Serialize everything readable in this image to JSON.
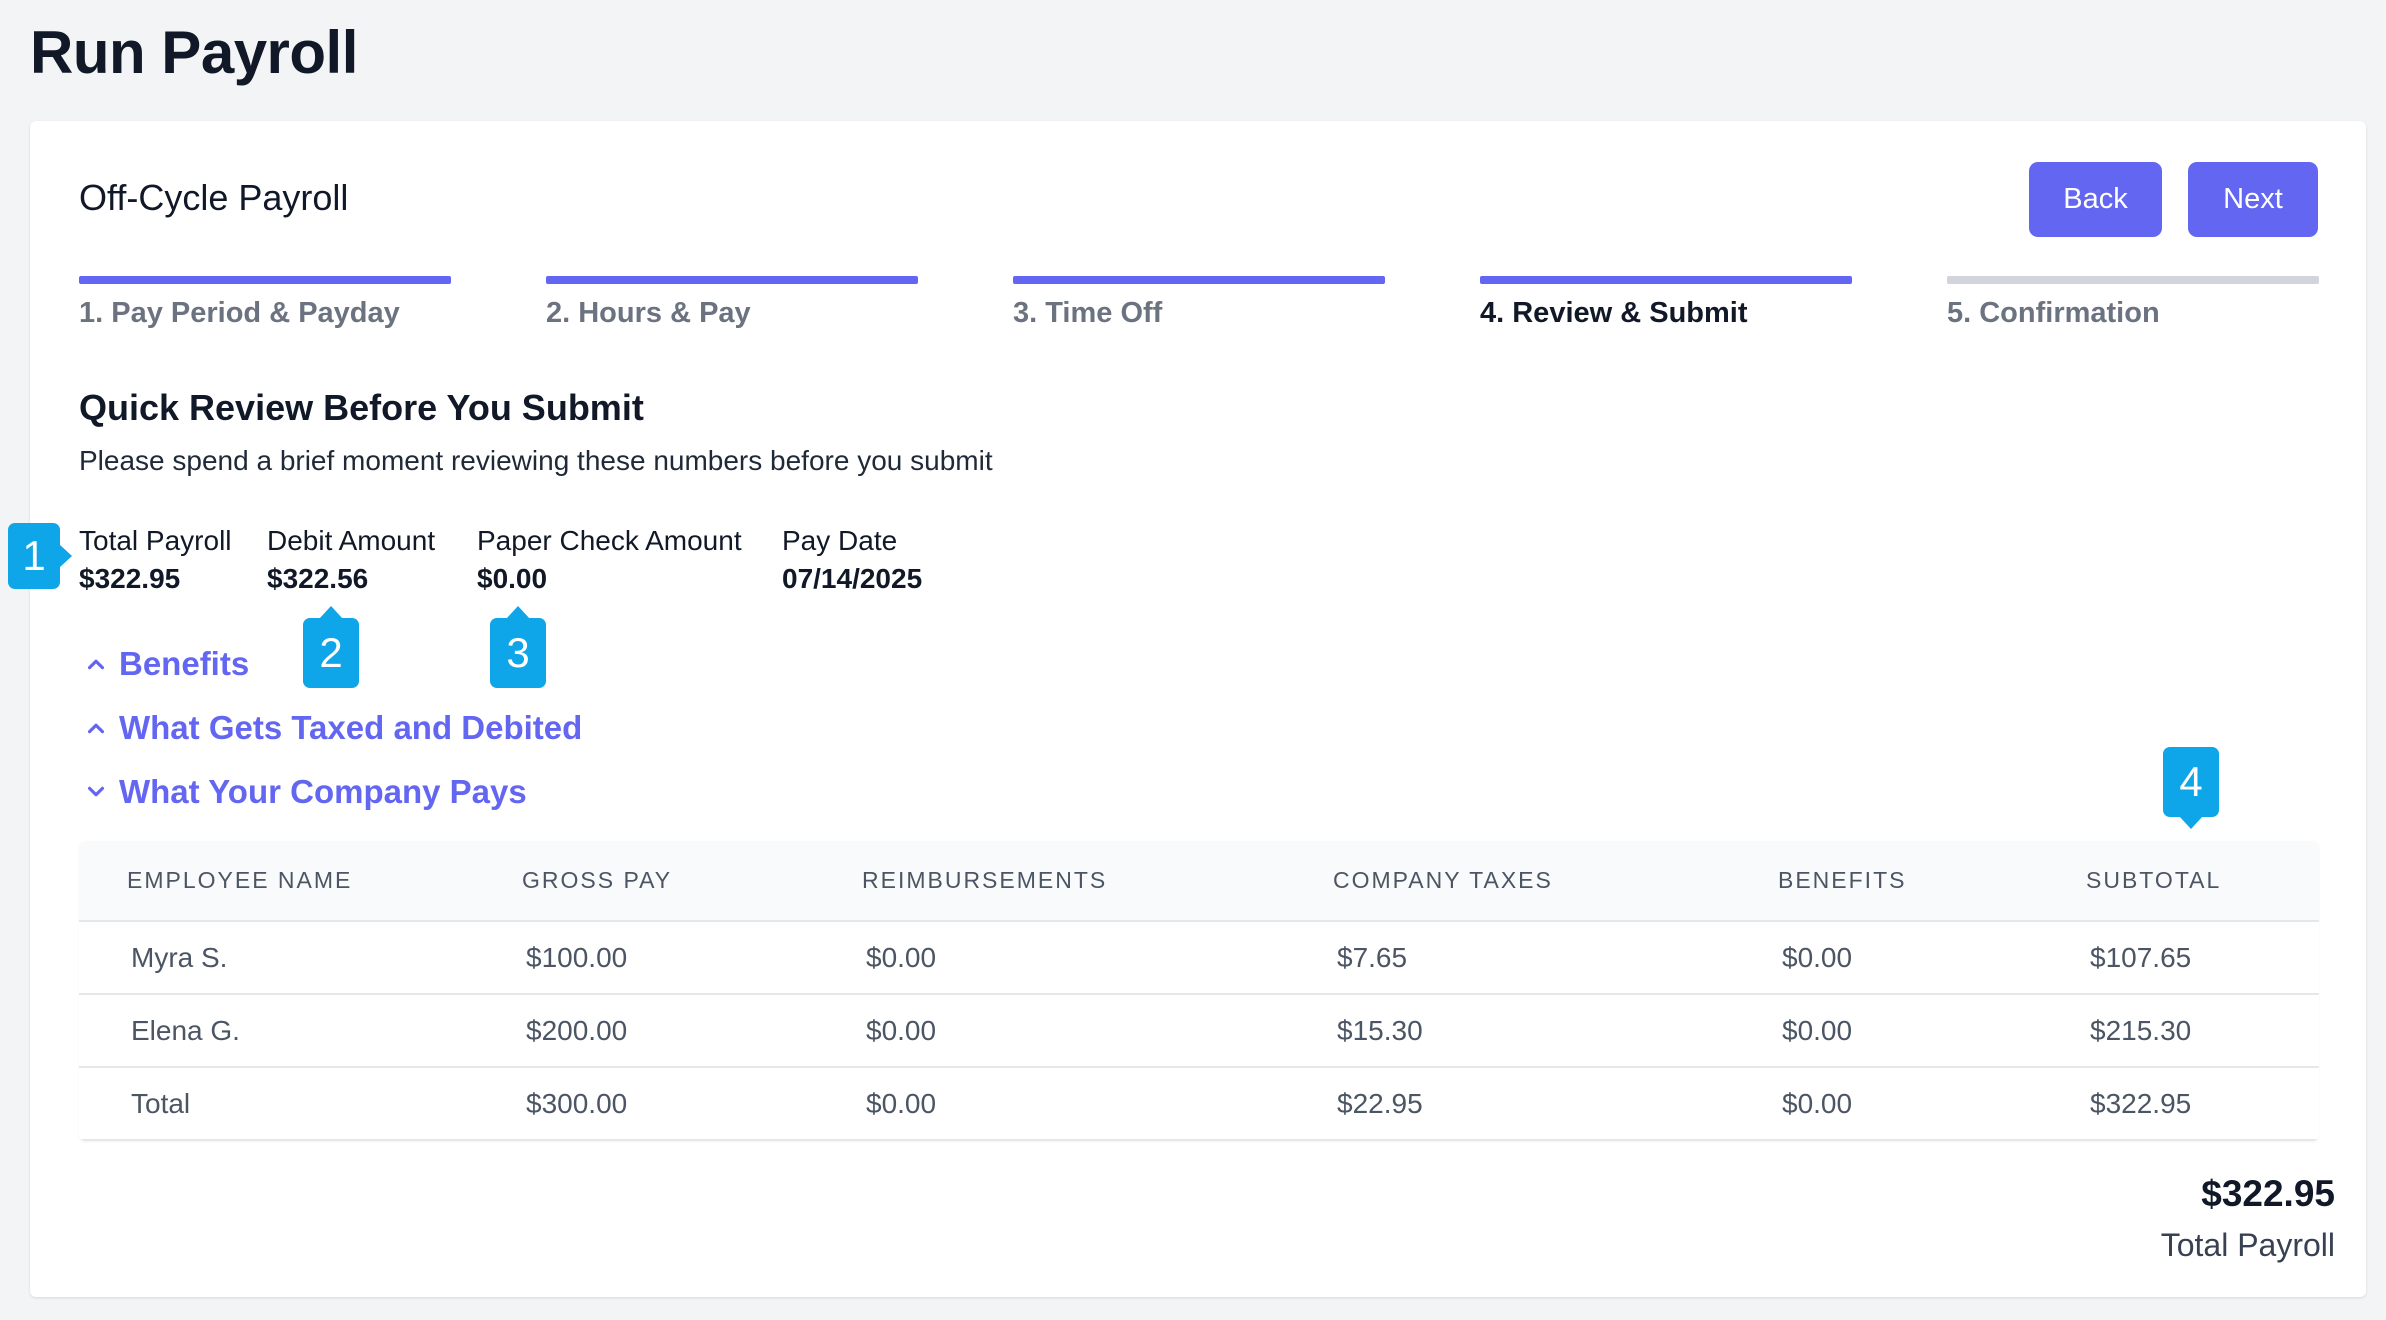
{
  "page": {
    "title": "Run Payroll"
  },
  "card": {
    "title": "Off-Cycle Payroll"
  },
  "actions": {
    "back_label": "Back",
    "next_label": "Next"
  },
  "colors": {
    "accent": "#6366f1",
    "badge": "#0ea5e9",
    "pending_step": "#d1d5db"
  },
  "steps": [
    {
      "label": "1. Pay Period & Payday",
      "state": "complete"
    },
    {
      "label": "2. Hours & Pay",
      "state": "complete"
    },
    {
      "label": "3. Time Off",
      "state": "complete"
    },
    {
      "label": "4. Review & Submit",
      "state": "active"
    },
    {
      "label": "5. Confirmation",
      "state": "pending"
    }
  ],
  "review": {
    "heading": "Quick Review Before You Submit",
    "subtitle": "Please spend a brief moment reviewing these numbers before you submit"
  },
  "summary": [
    {
      "label": "Total Payroll",
      "value": "$322.95"
    },
    {
      "label": "Debit Amount",
      "value": "$322.56"
    },
    {
      "label": "Paper Check Amount",
      "value": "$0.00"
    },
    {
      "label": "Pay Date",
      "value": "07/14/2025"
    }
  ],
  "sections": [
    {
      "label": "Benefits",
      "icon": "chevron-up-icon"
    },
    {
      "label": "What Gets Taxed and Debited",
      "icon": "chevron-up-icon"
    },
    {
      "label": "What Your Company Pays",
      "icon": "chevron-down-icon"
    }
  ],
  "table": {
    "columns": [
      "EMPLOYEE NAME",
      "GROSS PAY",
      "REIMBURSEMENTS",
      "COMPANY TAXES",
      "BENEFITS",
      "SUBTOTAL"
    ],
    "rows": [
      [
        "Myra S.",
        "$100.00",
        "$0.00",
        "$7.65",
        "$0.00",
        "$107.65"
      ],
      [
        "Elena G.",
        "$200.00",
        "$0.00",
        "$15.30",
        "$0.00",
        "$215.30"
      ],
      [
        "Total",
        "$300.00",
        "$0.00",
        "$22.95",
        "$0.00",
        "$322.95"
      ]
    ]
  },
  "total": {
    "amount": "$322.95",
    "label": "Total Payroll"
  },
  "badges": [
    "1",
    "2",
    "3",
    "4"
  ]
}
